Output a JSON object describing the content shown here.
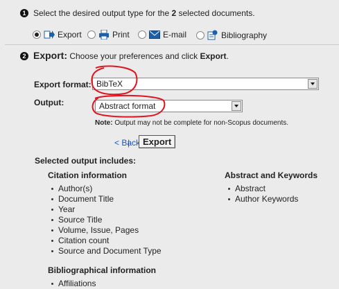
{
  "step1": {
    "number": "1",
    "prefix": "Select the desired output type for the ",
    "count": "2",
    "suffix": " selected documents.",
    "options": [
      {
        "label": "Export",
        "icon": "export-icon",
        "selected": true
      },
      {
        "label": "Print",
        "icon": "printer-icon",
        "selected": false
      },
      {
        "label": "E-mail",
        "icon": "envelope-icon",
        "selected": false
      },
      {
        "label": "Bibliography",
        "icon": "bibliography-icon",
        "selected": false
      }
    ]
  },
  "step2": {
    "number": "2",
    "title": "Export:",
    "subtitle_prefix": " Choose your preferences and click ",
    "subtitle_action": "Export",
    "subtitle_suffix": ".",
    "export_format_label": "Export format:",
    "export_format_value": "BibTeX",
    "output_label": "Output:",
    "output_value": "Abstract format",
    "note_label": "Note:",
    "note_text": " Output may not be complete for non-Scopus documents.",
    "back_link": "< Back",
    "separator": "|",
    "export_button": "Export"
  },
  "includes": {
    "heading": "Selected output includes:",
    "citation_heading": "Citation information",
    "citation_items": [
      "Author(s)",
      "Document Title",
      "Year",
      "Source Title",
      "Volume, Issue, Pages",
      "Citation count",
      "Source and Document Type"
    ],
    "abstract_heading": "Abstract and Keywords",
    "abstract_items": [
      "Abstract",
      "Author Keywords"
    ],
    "biblio_heading": "Bibliographical information",
    "biblio_items": [
      "Affiliations"
    ]
  },
  "colors": {
    "link": "#1a55c8",
    "annotation": "#e0141e",
    "background": "#ebebeb"
  }
}
